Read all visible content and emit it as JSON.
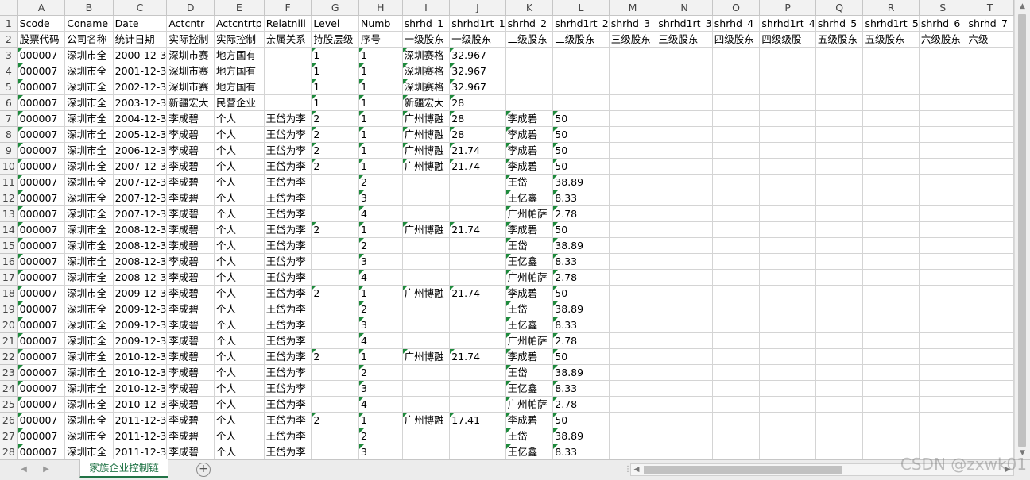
{
  "columns": [
    "A",
    "B",
    "C",
    "D",
    "E",
    "F",
    "G",
    "H",
    "I",
    "J",
    "K",
    "L",
    "M",
    "N",
    "O",
    "P",
    "Q",
    "R",
    "S",
    "T"
  ],
  "rows": [
    [
      "Scode",
      "Coname",
      "Date",
      "Actcntr",
      "Actcntrtp",
      "Relatnill",
      "Level",
      "Numb",
      "shrhd_1",
      "shrhd1rt_1",
      "shrhd_2",
      "shrhd1rt_2",
      "shrhd_3",
      "shrhd1rt_3",
      "shrhd_4",
      "shrhd1rt_4",
      "shrhd_5",
      "shrhd1rt_5",
      "shrhd_6",
      "shrhd_7"
    ],
    [
      "股票代码",
      "公司名称",
      "统计日期",
      "实际控制",
      "实际控制",
      "亲属关系",
      "持股层级",
      "序号",
      "一级股东",
      "一级股东",
      "二级股东",
      "二级股东",
      "三级股东",
      "三级股东",
      "四级股东",
      "四级级股",
      "五级股东",
      "五级股东",
      "六级股东",
      "六级"
    ],
    [
      "000007",
      "深圳市全",
      "2000-12-3",
      "深圳市赛",
      "地方国有",
      "",
      "1",
      "1",
      "深圳赛格",
      "32.967",
      "",
      "",
      "",
      "",
      "",
      "",
      "",
      "",
      "",
      ""
    ],
    [
      "000007",
      "深圳市全",
      "2001-12-3",
      "深圳市赛",
      "地方国有",
      "",
      "1",
      "1",
      "深圳赛格",
      "32.967",
      "",
      "",
      "",
      "",
      "",
      "",
      "",
      "",
      "",
      ""
    ],
    [
      "000007",
      "深圳市全",
      "2002-12-3",
      "深圳市赛",
      "地方国有",
      "",
      "1",
      "1",
      "深圳赛格",
      "32.967",
      "",
      "",
      "",
      "",
      "",
      "",
      "",
      "",
      "",
      ""
    ],
    [
      "000007",
      "深圳市全",
      "2003-12-3",
      "新疆宏大",
      "民营企业",
      "",
      "1",
      "1",
      "新疆宏大",
      "28",
      "",
      "",
      "",
      "",
      "",
      "",
      "",
      "",
      "",
      ""
    ],
    [
      "000007",
      "深圳市全",
      "2004-12-3",
      "李成碧",
      "个人",
      "王岱为李",
      "2",
      "1",
      "广州博融",
      "28",
      "李成碧",
      "50",
      "",
      "",
      "",
      "",
      "",
      "",
      "",
      ""
    ],
    [
      "000007",
      "深圳市全",
      "2005-12-3",
      "李成碧",
      "个人",
      "王岱为李",
      "2",
      "1",
      "广州博融",
      "28",
      "李成碧",
      "50",
      "",
      "",
      "",
      "",
      "",
      "",
      "",
      ""
    ],
    [
      "000007",
      "深圳市全",
      "2006-12-3",
      "李成碧",
      "个人",
      "王岱为李",
      "2",
      "1",
      "广州博融",
      "21.74",
      "李成碧",
      "50",
      "",
      "",
      "",
      "",
      "",
      "",
      "",
      ""
    ],
    [
      "000007",
      "深圳市全",
      "2007-12-3",
      "李成碧",
      "个人",
      "王岱为李",
      "2",
      "1",
      "广州博融",
      "21.74",
      "李成碧",
      "50",
      "",
      "",
      "",
      "",
      "",
      "",
      "",
      ""
    ],
    [
      "000007",
      "深圳市全",
      "2007-12-3",
      "李成碧",
      "个人",
      "王岱为李",
      "",
      "2",
      "",
      "",
      "王岱",
      "38.89",
      "",
      "",
      "",
      "",
      "",
      "",
      "",
      ""
    ],
    [
      "000007",
      "深圳市全",
      "2007-12-3",
      "李成碧",
      "个人",
      "王岱为李",
      "",
      "3",
      "",
      "",
      "王亿鑫",
      "8.33",
      "",
      "",
      "",
      "",
      "",
      "",
      "",
      ""
    ],
    [
      "000007",
      "深圳市全",
      "2007-12-3",
      "李成碧",
      "个人",
      "王岱为李",
      "",
      "4",
      "",
      "",
      "广州帕萨",
      "2.78",
      "",
      "",
      "",
      "",
      "",
      "",
      "",
      ""
    ],
    [
      "000007",
      "深圳市全",
      "2008-12-3",
      "李成碧",
      "个人",
      "王岱为李",
      "2",
      "1",
      "广州博融",
      "21.74",
      "李成碧",
      "50",
      "",
      "",
      "",
      "",
      "",
      "",
      "",
      ""
    ],
    [
      "000007",
      "深圳市全",
      "2008-12-3",
      "李成碧",
      "个人",
      "王岱为李",
      "",
      "2",
      "",
      "",
      "王岱",
      "38.89",
      "",
      "",
      "",
      "",
      "",
      "",
      "",
      ""
    ],
    [
      "000007",
      "深圳市全",
      "2008-12-3",
      "李成碧",
      "个人",
      "王岱为李",
      "",
      "3",
      "",
      "",
      "王亿鑫",
      "8.33",
      "",
      "",
      "",
      "",
      "",
      "",
      "",
      ""
    ],
    [
      "000007",
      "深圳市全",
      "2008-12-3",
      "李成碧",
      "个人",
      "王岱为李",
      "",
      "4",
      "",
      "",
      "广州帕萨",
      "2.78",
      "",
      "",
      "",
      "",
      "",
      "",
      "",
      ""
    ],
    [
      "000007",
      "深圳市全",
      "2009-12-3",
      "李成碧",
      "个人",
      "王岱为李",
      "2",
      "1",
      "广州博融",
      "21.74",
      "李成碧",
      "50",
      "",
      "",
      "",
      "",
      "",
      "",
      "",
      ""
    ],
    [
      "000007",
      "深圳市全",
      "2009-12-3",
      "李成碧",
      "个人",
      "王岱为李",
      "",
      "2",
      "",
      "",
      "王岱",
      "38.89",
      "",
      "",
      "",
      "",
      "",
      "",
      "",
      ""
    ],
    [
      "000007",
      "深圳市全",
      "2009-12-3",
      "李成碧",
      "个人",
      "王岱为李",
      "",
      "3",
      "",
      "",
      "王亿鑫",
      "8.33",
      "",
      "",
      "",
      "",
      "",
      "",
      "",
      ""
    ],
    [
      "000007",
      "深圳市全",
      "2009-12-3",
      "李成碧",
      "个人",
      "王岱为李",
      "",
      "4",
      "",
      "",
      "广州帕萨",
      "2.78",
      "",
      "",
      "",
      "",
      "",
      "",
      "",
      ""
    ],
    [
      "000007",
      "深圳市全",
      "2010-12-3",
      "李成碧",
      "个人",
      "王岱为李",
      "2",
      "1",
      "广州博融",
      "21.74",
      "李成碧",
      "50",
      "",
      "",
      "",
      "",
      "",
      "",
      "",
      ""
    ],
    [
      "000007",
      "深圳市全",
      "2010-12-3",
      "李成碧",
      "个人",
      "王岱为李",
      "",
      "2",
      "",
      "",
      "王岱",
      "38.89",
      "",
      "",
      "",
      "",
      "",
      "",
      "",
      ""
    ],
    [
      "000007",
      "深圳市全",
      "2010-12-3",
      "李成碧",
      "个人",
      "王岱为李",
      "",
      "3",
      "",
      "",
      "王亿鑫",
      "8.33",
      "",
      "",
      "",
      "",
      "",
      "",
      "",
      ""
    ],
    [
      "000007",
      "深圳市全",
      "2010-12-3",
      "李成碧",
      "个人",
      "王岱为李",
      "",
      "4",
      "",
      "",
      "广州帕萨",
      "2.78",
      "",
      "",
      "",
      "",
      "",
      "",
      "",
      ""
    ],
    [
      "000007",
      "深圳市全",
      "2011-12-3",
      "李成碧",
      "个人",
      "王岱为李",
      "2",
      "1",
      "广州博融",
      "17.41",
      "李成碧",
      "50",
      "",
      "",
      "",
      "",
      "",
      "",
      "",
      ""
    ],
    [
      "000007",
      "深圳市全",
      "2011-12-3",
      "李成碧",
      "个人",
      "王岱为李",
      "",
      "2",
      "",
      "",
      "王岱",
      "38.89",
      "",
      "",
      "",
      "",
      "",
      "",
      "",
      ""
    ],
    [
      "000007",
      "深圳市全",
      "2011-12-3",
      "李成碧",
      "个人",
      "王岱为李",
      "",
      "3",
      "",
      "",
      "王亿鑫",
      "8.33",
      "",
      "",
      "",
      "",
      "",
      "",
      "",
      ""
    ]
  ],
  "sheet_tab": "家族企业控制链",
  "watermark": "CSDN @zxwk01",
  "colors": {
    "accent": "#217346",
    "text_triangle": "#1e8a3c",
    "header_bg": "#f2f2f2"
  }
}
